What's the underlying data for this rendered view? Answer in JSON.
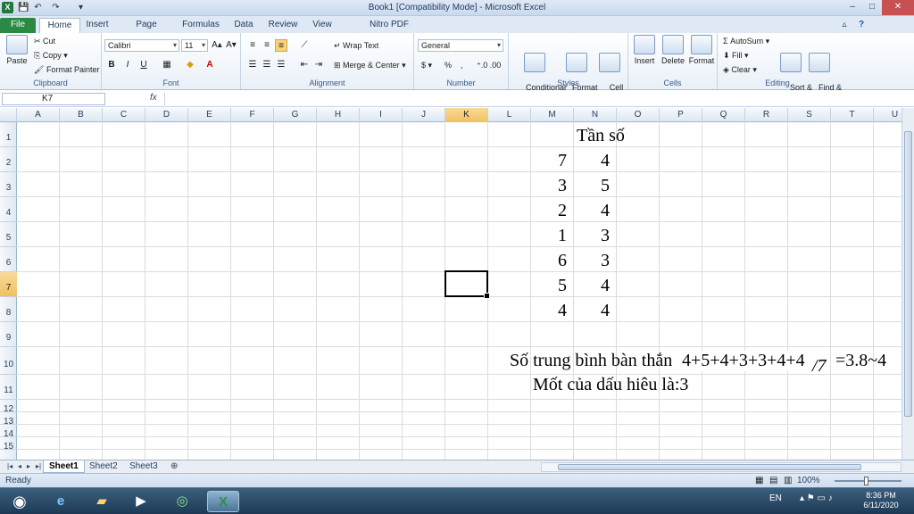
{
  "window": {
    "title": "Book1  [Compatibility Mode]  -  Microsoft Excel",
    "controls": {
      "minimize": "–",
      "maximize": "□",
      "close": "✕",
      "help": "?",
      "ribbon_min": "▵"
    }
  },
  "ribbon_tabs": [
    "File",
    "Home",
    "Insert",
    "Page Layout",
    "Formulas",
    "Data",
    "Review",
    "View",
    "Nitro PDF Professional"
  ],
  "ribbon": {
    "clipboard": {
      "label": "Clipboard",
      "paste": "Paste",
      "cut": "Cut",
      "copy": "Copy ▾",
      "format_painter": "Format Painter"
    },
    "font": {
      "label": "Font",
      "name": "Calibri",
      "size": "11",
      "bold": "B",
      "italic": "I",
      "underline": "U",
      "grow": "A▴",
      "shrink": "A▾"
    },
    "alignment": {
      "label": "Alignment",
      "wrap": "Wrap Text",
      "merge": "Merge & Center ▾"
    },
    "number": {
      "label": "Number",
      "format": "General",
      "currency": "$ ▾",
      "percent": "%",
      "comma": ",",
      "inc_dec": "⁺.0 .00"
    },
    "styles": {
      "label": "Styles",
      "conditional": "Conditional\nFormatting ▾",
      "format_table": "Format\nas Table ▾",
      "cell_styles": "Cell\nStyles ▾"
    },
    "cells": {
      "label": "Cells",
      "insert": "Insert",
      "delete": "Delete",
      "format": "Format"
    },
    "editing": {
      "label": "Editing",
      "autosum": "Σ AutoSum ▾",
      "fill": "Fill ▾",
      "clear": "Clear ▾",
      "sort": "Sort &\nFilter ▾",
      "find": "Find &\nSelect ▾"
    }
  },
  "formula_bar": {
    "name_box": "K7",
    "fx": "fx",
    "formula": ""
  },
  "columns": [
    "A",
    "B",
    "C",
    "D",
    "E",
    "F",
    "G",
    "H",
    "I",
    "J",
    "K",
    "L",
    "M",
    "N",
    "O",
    "P",
    "Q",
    "R",
    "S",
    "T",
    "U"
  ],
  "rows": [
    "1",
    "2",
    "3",
    "4",
    "5",
    "6",
    "7",
    "8",
    "9",
    "10",
    "11",
    "12",
    "13",
    "14",
    "15"
  ],
  "selected_cell": {
    "col": "K",
    "row": "7"
  },
  "cells": {
    "header_tan_so": "Tần số",
    "M": [
      "7",
      "3",
      "2",
      "1",
      "6",
      "5",
      "4"
    ],
    "N": [
      "4",
      "5",
      "4",
      "3",
      "3",
      "4",
      "4"
    ],
    "row10_text": "Số trung bình bàn thắn",
    "row10_formula": "4+5+4+3+3+4+4",
    "row10_div": "/7",
    "row10_result": "=3.8~4",
    "row11_text": "Mốt của dấu hiêu là:3"
  },
  "sheets": [
    "Sheet1",
    "Sheet2",
    "Sheet3"
  ],
  "active_sheet": "Sheet1",
  "status": {
    "state": "Ready",
    "zoom": "100%"
  },
  "taskbar": {
    "lang": "EN",
    "time": "8:36 PM",
    "date": "6/11/2020"
  }
}
